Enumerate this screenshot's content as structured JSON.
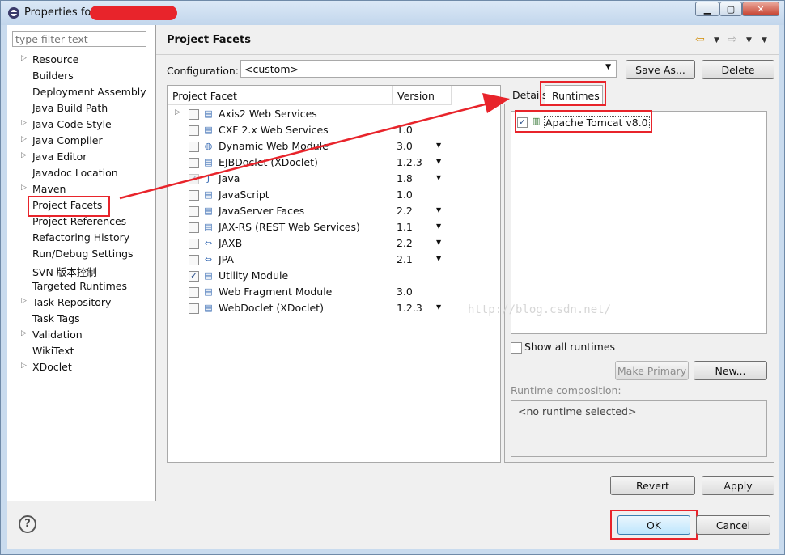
{
  "window": {
    "title": "Properties for"
  },
  "filter": {
    "placeholder": "type filter text"
  },
  "tree": [
    {
      "label": "Resource",
      "expandable": true
    },
    {
      "label": "Builders",
      "expandable": false
    },
    {
      "label": "Deployment Assembly",
      "expandable": false
    },
    {
      "label": "Java Build Path",
      "expandable": false
    },
    {
      "label": "Java Code Style",
      "expandable": true
    },
    {
      "label": "Java Compiler",
      "expandable": true
    },
    {
      "label": "Java Editor",
      "expandable": true
    },
    {
      "label": "Javadoc Location",
      "expandable": false
    },
    {
      "label": "Maven",
      "expandable": true
    },
    {
      "label": "Project Facets",
      "expandable": false,
      "selected": true
    },
    {
      "label": "Project References",
      "expandable": false
    },
    {
      "label": "Refactoring History",
      "expandable": false
    },
    {
      "label": "Run/Debug Settings",
      "expandable": false
    },
    {
      "label": "SVN 版本控制",
      "expandable": false
    },
    {
      "label": "Targeted Runtimes",
      "expandable": false
    },
    {
      "label": "Task Repository",
      "expandable": true
    },
    {
      "label": "Task Tags",
      "expandable": false
    },
    {
      "label": "Validation",
      "expandable": true
    },
    {
      "label": "WikiText",
      "expandable": false
    },
    {
      "label": "XDoclet",
      "expandable": true
    }
  ],
  "page": {
    "title": "Project Facets"
  },
  "config": {
    "label": "Configuration:",
    "value": "<custom>",
    "save_as": "Save As...",
    "delete": "Delete"
  },
  "facets": {
    "col_facet": "Project Facet",
    "col_version": "Version",
    "rows": [
      {
        "name": "Axis2 Web Services",
        "version": "",
        "checked": false,
        "expandable": true,
        "icon": "page-icon",
        "dropdown": false
      },
      {
        "name": "CXF 2.x Web Services",
        "version": "1.0",
        "checked": false,
        "expandable": false,
        "icon": "page-icon",
        "dropdown": false
      },
      {
        "name": "Dynamic Web Module",
        "version": "3.0",
        "checked": false,
        "expandable": false,
        "icon": "globe-icon",
        "dropdown": true
      },
      {
        "name": "EJBDoclet (XDoclet)",
        "version": "1.2.3",
        "checked": false,
        "expandable": false,
        "icon": "page-icon",
        "dropdown": true
      },
      {
        "name": "Java",
        "version": "1.8",
        "checked": true,
        "disabled": true,
        "expandable": false,
        "icon": "java-icon",
        "dropdown": true
      },
      {
        "name": "JavaScript",
        "version": "1.0",
        "checked": false,
        "expandable": false,
        "icon": "page-icon",
        "dropdown": false
      },
      {
        "name": "JavaServer Faces",
        "version": "2.2",
        "checked": false,
        "expandable": false,
        "icon": "page-icon",
        "dropdown": true
      },
      {
        "name": "JAX-RS (REST Web Services)",
        "version": "1.1",
        "checked": false,
        "expandable": false,
        "icon": "page-icon",
        "dropdown": true
      },
      {
        "name": "JAXB",
        "version": "2.2",
        "checked": false,
        "expandable": false,
        "icon": "jax-icon",
        "dropdown": true
      },
      {
        "name": "JPA",
        "version": "2.1",
        "checked": false,
        "expandable": false,
        "icon": "jax-icon",
        "dropdown": true
      },
      {
        "name": "Utility Module",
        "version": "",
        "checked": true,
        "expandable": false,
        "icon": "page-icon",
        "dropdown": false
      },
      {
        "name": "Web Fragment Module",
        "version": "3.0",
        "checked": false,
        "expandable": false,
        "icon": "page-icon",
        "dropdown": false
      },
      {
        "name": "WebDoclet (XDoclet)",
        "version": "1.2.3",
        "checked": false,
        "expandable": false,
        "icon": "page-icon",
        "dropdown": true
      }
    ]
  },
  "tabs": {
    "details": "Details",
    "runtimes": "Runtimes"
  },
  "runtimes": {
    "items": [
      {
        "name": "Apache Tomcat v8.0",
        "checked": true
      }
    ],
    "show_all": "Show all runtimes",
    "make_primary": "Make Primary",
    "new": "New...",
    "composition_label": "Runtime composition:",
    "composition_value": "<no runtime selected>"
  },
  "watermark": "http://blog.csdn.net/",
  "buttons": {
    "revert": "Revert",
    "apply": "Apply",
    "ok": "OK",
    "cancel": "Cancel"
  },
  "colors": {
    "highlight": "#e8242b",
    "selection": "#3399ff"
  }
}
